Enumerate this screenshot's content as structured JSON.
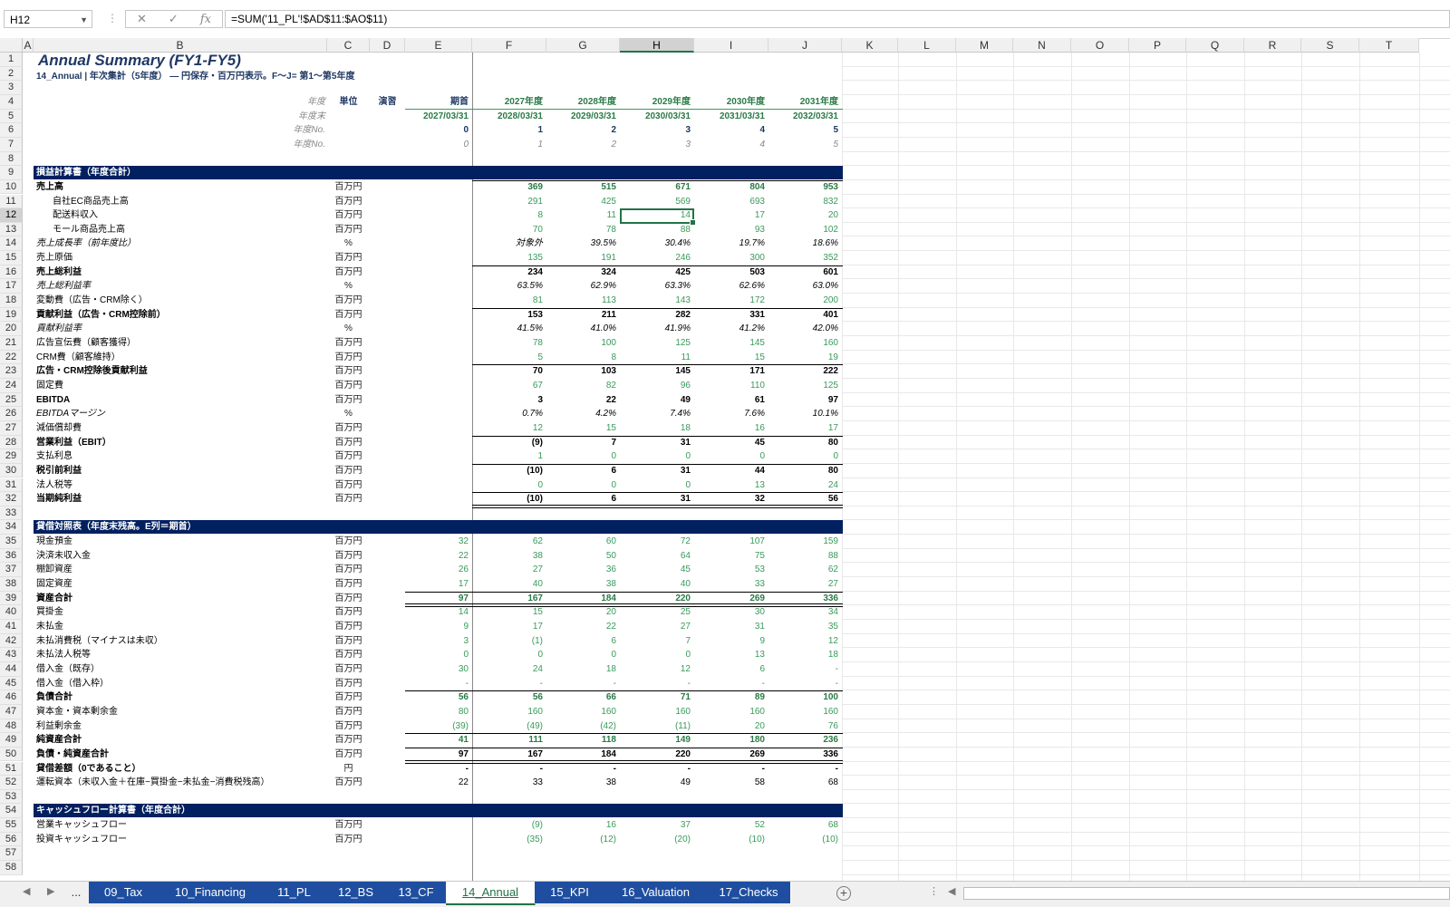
{
  "formula_bar": {
    "name_box": "H12",
    "formula": "=SUM('11_PL'!$AD$11:$AO$11)"
  },
  "columns": [
    "A",
    "B",
    "C",
    "D",
    "E",
    "F",
    "G",
    "H",
    "I",
    "J",
    "K",
    "L",
    "M",
    "N",
    "O",
    "P",
    "Q",
    "R",
    "S",
    "T"
  ],
  "title": "Annual Summary (FY1-FY5)",
  "subtitle": "14_Annual | 年次集計（5年度） ― 円保存・百万円表示。F～J= 第1～第5年度",
  "header_rows": {
    "r4": {
      "label": "年度",
      "unit": "単位",
      "note": "演習",
      "E": "期首",
      "F": "2027年度",
      "G": "2028年度",
      "H": "2029年度",
      "I": "2030年度",
      "J": "2031年度"
    },
    "r5": {
      "label": "年度末",
      "E": "2027/03/31",
      "F": "2028/03/31",
      "G": "2029/03/31",
      "H": "2030/03/31",
      "I": "2031/03/31",
      "J": "2032/03/31"
    },
    "r6": {
      "label": "年度No.",
      "E": "0",
      "F": "1",
      "G": "2",
      "H": "3",
      "I": "4",
      "J": "5"
    },
    "r7": {
      "label": "年度No.",
      "E": "0",
      "F": "1",
      "G": "2",
      "H": "3",
      "I": "4",
      "J": "5"
    }
  },
  "sections": {
    "pl": "損益計算書（年度合計）",
    "bs": "貸借対照表（年度末残高。E列＝期首）",
    "cf": "キャッシュフロー計算書（年度合計）"
  },
  "rows": [
    {
      "n": "10",
      "label": "売上高",
      "unit": "百万円",
      "E": "",
      "v": [
        "369",
        "515",
        "671",
        "804",
        "953"
      ],
      "style": "green-b",
      "lb": true
    },
    {
      "n": "11",
      "label": "自社EC商品売上高",
      "unit": "百万円",
      "E": "",
      "v": [
        "291",
        "425",
        "569",
        "693",
        "832"
      ],
      "style": "green",
      "indent": true
    },
    {
      "n": "12",
      "label": "配送料収入",
      "unit": "百万円",
      "E": "",
      "v": [
        "8",
        "11",
        "14",
        "17",
        "20"
      ],
      "style": "green",
      "indent": true
    },
    {
      "n": "13",
      "label": "モール商品売上高",
      "unit": "百万円",
      "E": "",
      "v": [
        "70",
        "78",
        "88",
        "93",
        "102"
      ],
      "style": "green",
      "indent": true
    },
    {
      "n": "14",
      "label": "売上成長率（前年度比）",
      "unit": "%",
      "E": "",
      "v": [
        "対象外",
        "39.5%",
        "30.4%",
        "19.7%",
        "18.6%"
      ],
      "style": "i",
      "li": true
    },
    {
      "n": "15",
      "label": "売上原価",
      "unit": "百万円",
      "E": "",
      "v": [
        "135",
        "191",
        "246",
        "300",
        "352"
      ],
      "style": "green"
    },
    {
      "n": "16",
      "label": "売上総利益",
      "unit": "百万円",
      "E": "",
      "v": [
        "234",
        "324",
        "425",
        "503",
        "601"
      ],
      "style": "b",
      "lb": true
    },
    {
      "n": "17",
      "label": "売上総利益率",
      "unit": "%",
      "E": "",
      "v": [
        "63.5%",
        "62.9%",
        "63.3%",
        "62.6%",
        "63.0%"
      ],
      "style": "i",
      "li": true
    },
    {
      "n": "18",
      "label": "変動費（広告・CRM除く）",
      "unit": "百万円",
      "E": "",
      "v": [
        "81",
        "113",
        "143",
        "172",
        "200"
      ],
      "style": "green"
    },
    {
      "n": "19",
      "label": "貢献利益（広告・CRM控除前）",
      "unit": "百万円",
      "E": "",
      "v": [
        "153",
        "211",
        "282",
        "331",
        "401"
      ],
      "style": "b",
      "lb": true
    },
    {
      "n": "20",
      "label": "貢献利益率",
      "unit": "%",
      "E": "",
      "v": [
        "41.5%",
        "41.0%",
        "41.9%",
        "41.2%",
        "42.0%"
      ],
      "style": "i",
      "li": true
    },
    {
      "n": "21",
      "label": "広告宣伝費（顧客獲得）",
      "unit": "百万円",
      "E": "",
      "v": [
        "78",
        "100",
        "125",
        "145",
        "160"
      ],
      "style": "green"
    },
    {
      "n": "22",
      "label": "CRM費（顧客維持）",
      "unit": "百万円",
      "E": "",
      "v": [
        "5",
        "8",
        "11",
        "15",
        "19"
      ],
      "style": "green"
    },
    {
      "n": "23",
      "label": "広告・CRM控除後貢献利益",
      "unit": "百万円",
      "E": "",
      "v": [
        "70",
        "103",
        "145",
        "171",
        "222"
      ],
      "style": "b",
      "lb": true
    },
    {
      "n": "24",
      "label": "固定費",
      "unit": "百万円",
      "E": "",
      "v": [
        "67",
        "82",
        "96",
        "110",
        "125"
      ],
      "style": "green"
    },
    {
      "n": "25",
      "label": "EBITDA",
      "unit": "百万円",
      "E": "",
      "v": [
        "3",
        "22",
        "49",
        "61",
        "97"
      ],
      "style": "b"
    },
    {
      "n": "26",
      "label": "EBITDAマージン",
      "unit": "%",
      "E": "",
      "v": [
        "0.7%",
        "4.2%",
        "7.4%",
        "7.6%",
        "10.1%"
      ],
      "style": "i",
      "li": true
    },
    {
      "n": "27",
      "label": "減価償却費",
      "unit": "百万円",
      "E": "",
      "v": [
        "12",
        "15",
        "18",
        "16",
        "17"
      ],
      "style": "green"
    },
    {
      "n": "28",
      "label": "営業利益（EBIT）",
      "unit": "百万円",
      "E": "",
      "v": [
        "(9)",
        "7",
        "31",
        "45",
        "80"
      ],
      "style": "b",
      "lb": true
    },
    {
      "n": "29",
      "label": "支払利息",
      "unit": "百万円",
      "E": "",
      "v": [
        "1",
        "0",
        "0",
        "0",
        "0"
      ],
      "style": "green"
    },
    {
      "n": "30",
      "label": "税引前利益",
      "unit": "百万円",
      "E": "",
      "v": [
        "(10)",
        "6",
        "31",
        "44",
        "80"
      ],
      "style": "b",
      "lb": true
    },
    {
      "n": "31",
      "label": "法人税等",
      "unit": "百万円",
      "E": "",
      "v": [
        "0",
        "0",
        "0",
        "13",
        "24"
      ],
      "style": "green"
    },
    {
      "n": "32",
      "label": "当期純利益",
      "unit": "百万円",
      "E": "",
      "v": [
        "(10)",
        "6",
        "31",
        "32",
        "56"
      ],
      "style": "b",
      "lb": true
    },
    {
      "n": "35",
      "label": "現金預金",
      "unit": "百万円",
      "E": "32",
      "v": [
        "62",
        "60",
        "72",
        "107",
        "159"
      ],
      "style": "green"
    },
    {
      "n": "36",
      "label": "決済未収入金",
      "unit": "百万円",
      "E": "22",
      "v": [
        "38",
        "50",
        "64",
        "75",
        "88"
      ],
      "style": "green"
    },
    {
      "n": "37",
      "label": "棚卸資産",
      "unit": "百万円",
      "E": "26",
      "v": [
        "27",
        "36",
        "45",
        "53",
        "62"
      ],
      "style": "green"
    },
    {
      "n": "38",
      "label": "固定資産",
      "unit": "百万円",
      "E": "17",
      "v": [
        "40",
        "38",
        "40",
        "33",
        "27"
      ],
      "style": "green"
    },
    {
      "n": "39",
      "label": "資産合計",
      "unit": "百万円",
      "E": "97",
      "v": [
        "167",
        "184",
        "220",
        "269",
        "336"
      ],
      "style": "green-b",
      "lb": true
    },
    {
      "n": "40",
      "label": "買掛金",
      "unit": "百万円",
      "E": "14",
      "v": [
        "15",
        "20",
        "25",
        "30",
        "34"
      ],
      "style": "green"
    },
    {
      "n": "41",
      "label": "未払金",
      "unit": "百万円",
      "E": "9",
      "v": [
        "17",
        "22",
        "27",
        "31",
        "35"
      ],
      "style": "green"
    },
    {
      "n": "42",
      "label": "未払消費税（マイナスは未収）",
      "unit": "百万円",
      "E": "3",
      "v": [
        "(1)",
        "6",
        "7",
        "9",
        "12"
      ],
      "style": "green"
    },
    {
      "n": "43",
      "label": "未払法人税等",
      "unit": "百万円",
      "E": "0",
      "v": [
        "0",
        "0",
        "0",
        "13",
        "18"
      ],
      "style": "green"
    },
    {
      "n": "44",
      "label": "借入金（既存）",
      "unit": "百万円",
      "E": "30",
      "v": [
        "24",
        "18",
        "12",
        "6",
        "-"
      ],
      "style": "green"
    },
    {
      "n": "45",
      "label": "借入金（借入枠）",
      "unit": "百万円",
      "E": "-",
      "v": [
        "-",
        "-",
        "-",
        "-",
        "-"
      ],
      "style": "green"
    },
    {
      "n": "46",
      "label": "負債合計",
      "unit": "百万円",
      "E": "56",
      "v": [
        "56",
        "66",
        "71",
        "89",
        "100"
      ],
      "style": "green-b",
      "lb": true
    },
    {
      "n": "47",
      "label": "資本金・資本剰余金",
      "unit": "百万円",
      "E": "80",
      "v": [
        "160",
        "160",
        "160",
        "160",
        "160"
      ],
      "style": "green"
    },
    {
      "n": "48",
      "label": "利益剰余金",
      "unit": "百万円",
      "E": "(39)",
      "v": [
        "(49)",
        "(42)",
        "(11)",
        "20",
        "76"
      ],
      "style": "green"
    },
    {
      "n": "49",
      "label": "純資産合計",
      "unit": "百万円",
      "E": "41",
      "v": [
        "111",
        "118",
        "149",
        "180",
        "236"
      ],
      "style": "green-b",
      "lb": true
    },
    {
      "n": "50",
      "label": "負債・純資産合計",
      "unit": "百万円",
      "E": "97",
      "v": [
        "167",
        "184",
        "220",
        "269",
        "336"
      ],
      "style": "b",
      "lb": true
    },
    {
      "n": "51",
      "label": "貸借差額（0であること）",
      "unit": "円",
      "E": "-",
      "v": [
        "-",
        "-",
        "-",
        "-",
        "-"
      ],
      "style": "b"
    },
    {
      "n": "52",
      "label": "運転資本（未収入金＋在庫−買掛金−未払金−消費税残高）",
      "unit": "百万円",
      "E": "22",
      "v": [
        "33",
        "38",
        "49",
        "58",
        "68"
      ],
      "style": ""
    },
    {
      "n": "55",
      "label": "営業キャッシュフロー",
      "unit": "百万円",
      "E": "",
      "v": [
        "(9)",
        "16",
        "37",
        "52",
        "68"
      ],
      "style": "green"
    },
    {
      "n": "56",
      "label": "投資キャッシュフロー",
      "unit": "百万円",
      "E": "",
      "v": [
        "(35)",
        "(12)",
        "(20)",
        "(10)",
        "(10)"
      ],
      "style": "green"
    }
  ],
  "tabs": [
    "...",
    "09_Tax",
    "10_Financing",
    "11_PL",
    "12_BS",
    "13_CF",
    "14_Annual",
    "15_KPI",
    "16_Valuation",
    "17_Checks"
  ],
  "active_tab": "14_Annual"
}
